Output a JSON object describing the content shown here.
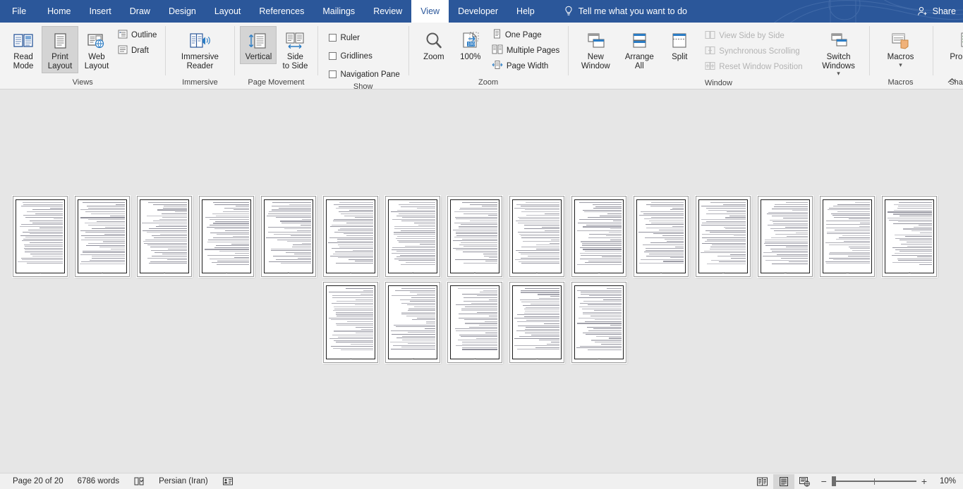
{
  "app": {
    "title": "Microsoft Word",
    "theme_accent": "#2b579a"
  },
  "tabs": [
    {
      "label": "File",
      "active": false
    },
    {
      "label": "Home",
      "active": false
    },
    {
      "label": "Insert",
      "active": false
    },
    {
      "label": "Draw",
      "active": false
    },
    {
      "label": "Design",
      "active": false
    },
    {
      "label": "Layout",
      "active": false
    },
    {
      "label": "References",
      "active": false
    },
    {
      "label": "Mailings",
      "active": false
    },
    {
      "label": "Review",
      "active": false
    },
    {
      "label": "View",
      "active": true
    },
    {
      "label": "Developer",
      "active": false
    },
    {
      "label": "Help",
      "active": false
    }
  ],
  "tellme": {
    "label": "Tell me what you want to do",
    "icon": "lightbulb-icon"
  },
  "share": {
    "label": "Share",
    "icon": "person-add-icon"
  },
  "ribbon": {
    "collapse_icon": "chevron-up-icon",
    "groups": [
      {
        "name": "Views",
        "title": "Views",
        "big_buttons": [
          {
            "label": "Read\nMode",
            "icon": "read-mode-icon",
            "selected": false
          },
          {
            "label": "Print\nLayout",
            "icon": "print-layout-icon",
            "selected": true
          },
          {
            "label": "Web\nLayout",
            "icon": "web-layout-icon",
            "selected": false
          }
        ],
        "small_buttons": [
          {
            "label": "Outline",
            "icon": "outline-icon"
          },
          {
            "label": "Draft",
            "icon": "draft-icon"
          }
        ]
      },
      {
        "name": "Immersive",
        "title": "Immersive",
        "big_buttons": [
          {
            "label": "Immersive\nReader",
            "icon": "immersive-reader-icon",
            "selected": false
          }
        ],
        "small_buttons": []
      },
      {
        "name": "Page Movement",
        "title": "Page Movement",
        "big_buttons": [
          {
            "label": "Vertical",
            "icon": "vertical-scroll-icon",
            "selected": true
          },
          {
            "label": "Side\nto Side",
            "icon": "side-to-side-icon",
            "selected": false
          }
        ],
        "small_buttons": []
      },
      {
        "name": "Show",
        "title": "Show",
        "big_buttons": [],
        "checkboxes": [
          {
            "label": "Ruler",
            "checked": false
          },
          {
            "label": "Gridlines",
            "checked": false
          },
          {
            "label": "Navigation Pane",
            "checked": false
          }
        ]
      },
      {
        "name": "Zoom",
        "title": "Zoom",
        "big_buttons": [
          {
            "label": "Zoom",
            "icon": "magnifier-icon",
            "selected": false
          },
          {
            "label": "100%",
            "icon": "zoom-100-icon",
            "selected": false
          }
        ],
        "small_buttons": [
          {
            "label": "One Page",
            "icon": "one-page-icon"
          },
          {
            "label": "Multiple Pages",
            "icon": "multiple-pages-icon"
          },
          {
            "label": "Page Width",
            "icon": "page-width-icon"
          }
        ]
      },
      {
        "name": "Window",
        "title": "Window",
        "big_buttons": [
          {
            "label": "New\nWindow",
            "icon": "new-window-icon",
            "selected": false
          },
          {
            "label": "Arrange\nAll",
            "icon": "arrange-all-icon",
            "selected": false
          },
          {
            "label": "Split",
            "icon": "split-icon",
            "selected": false
          }
        ],
        "small_buttons": [
          {
            "label": "View Side by Side",
            "icon": "side-by-side-icon",
            "disabled": true
          },
          {
            "label": "Synchronous Scrolling",
            "icon": "sync-scroll-icon",
            "disabled": true
          },
          {
            "label": "Reset Window Position",
            "icon": "reset-window-icon",
            "disabled": true
          }
        ],
        "big_buttons_2": [
          {
            "label": "Switch\nWindows",
            "icon": "switch-windows-icon",
            "dropdown": true
          }
        ]
      },
      {
        "name": "Macros",
        "title": "Macros",
        "big_buttons": [
          {
            "label": "Macros",
            "icon": "macros-icon",
            "dropdown": true
          }
        ]
      },
      {
        "name": "SharePoint",
        "title": "SharePoint",
        "big_buttons": [
          {
            "label": "Properties",
            "icon": "sharepoint-properties-icon",
            "selected": false
          }
        ]
      }
    ]
  },
  "document": {
    "row1_page_count": 15,
    "row2_page_count": 5,
    "page_numbers_row1": [
      "1",
      "2",
      "3",
      "4",
      "5",
      "6",
      "7",
      "8",
      "9",
      "10",
      "11",
      "12",
      "13",
      "14",
      "15"
    ],
    "page_numbers_row2": [
      "16",
      "17",
      "18",
      "19",
      "20"
    ]
  },
  "statusbar": {
    "page_indicator": "Page 20 of 20",
    "word_count": "6786 words",
    "proofing_icon": "proofing-errors-icon",
    "language": "Persian (Iran)",
    "accessibility_icon": "accessibility-icon",
    "view_buttons": [
      {
        "name": "read-mode-view",
        "icon": "read-mode-view-icon",
        "selected": false
      },
      {
        "name": "print-layout-view",
        "icon": "print-layout-view-icon",
        "selected": true
      },
      {
        "name": "web-layout-view",
        "icon": "web-layout-view-icon",
        "selected": false
      }
    ],
    "zoom_out_label": "−",
    "zoom_in_label": "+",
    "zoom_level": "10%"
  }
}
